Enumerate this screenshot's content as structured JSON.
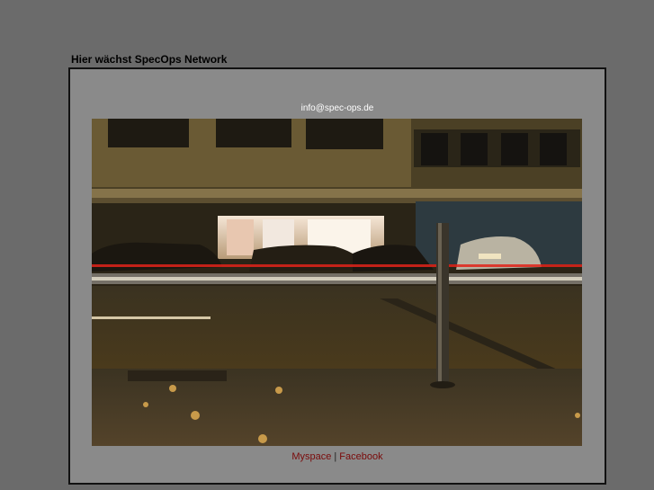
{
  "header": {
    "title": "Hier wächst SpecOps Network"
  },
  "content": {
    "email": "info@spec-ops.de",
    "photo_icon": "night-street-photo"
  },
  "footer": {
    "myspace_label": "Myspace",
    "separator": "|",
    "facebook_label": "Facebook"
  }
}
